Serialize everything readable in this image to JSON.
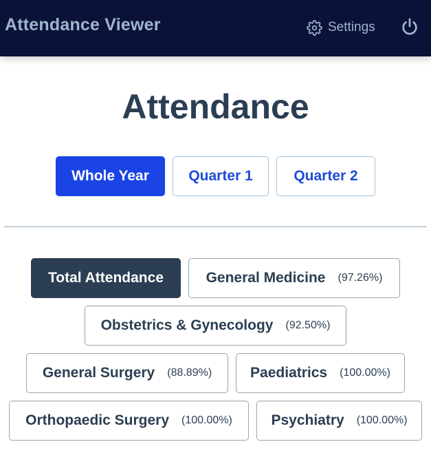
{
  "header": {
    "app_title": "Attendance Viewer",
    "settings_label": "Settings"
  },
  "page": {
    "title": "Attendance"
  },
  "tabs": [
    {
      "label": "Whole Year",
      "active": true
    },
    {
      "label": "Quarter 1",
      "active": false
    },
    {
      "label": "Quarter 2",
      "active": false
    }
  ],
  "departments": [
    {
      "name": "Total Attendance",
      "percent": "",
      "selected": true
    },
    {
      "name": "General Medicine",
      "percent": "(97.26%)"
    },
    {
      "name": "Obstetrics & Gynecology",
      "percent": "(92.50%)"
    },
    {
      "name": "General Surgery",
      "percent": "(88.89%)"
    },
    {
      "name": "Paediatrics",
      "percent": "(100.00%)"
    },
    {
      "name": "Orthopaedic Surgery",
      "percent": "(100.00%)"
    },
    {
      "name": "Psychiatry",
      "percent": "(100.00%)"
    }
  ],
  "colors": {
    "topbar": "#0b1239",
    "topbar_text": "#9fb5cd",
    "accent": "#1a44e4",
    "dark": "#2b3e53"
  },
  "icons": {
    "settings": "gear-icon",
    "power": "power-icon"
  }
}
